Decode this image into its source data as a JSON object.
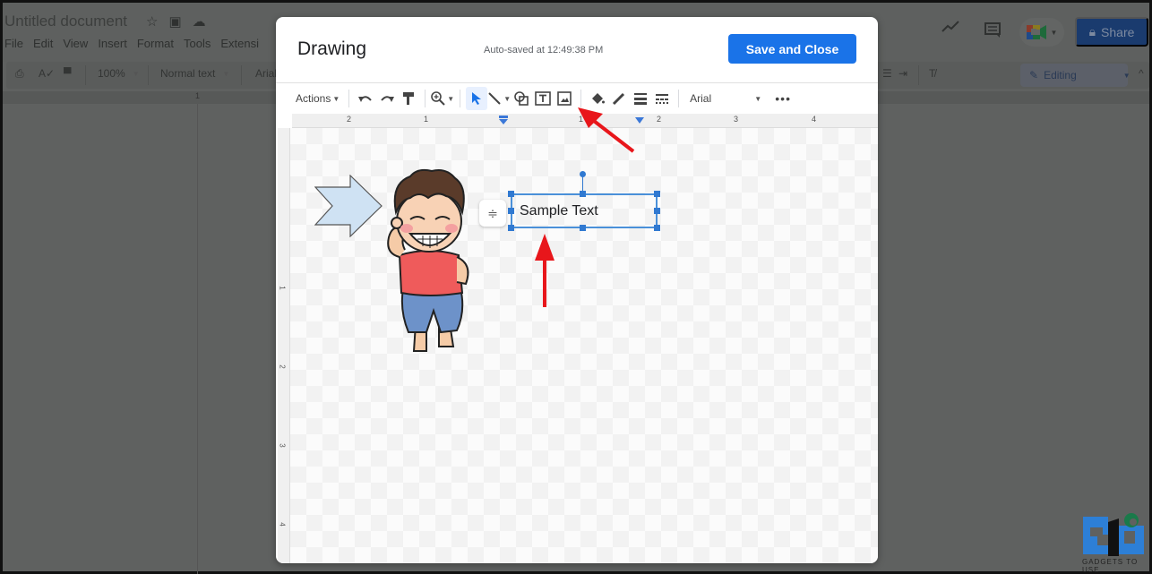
{
  "app": {
    "document_title": "Untitled document",
    "menu": [
      "File",
      "Edit",
      "View",
      "Insert",
      "Format",
      "Tools",
      "Extensi"
    ],
    "toolbar": {
      "zoom": "100%",
      "style": "Normal text",
      "font": "Arial"
    },
    "share_label": "Share",
    "mode_label": "Editing",
    "ruler_mark": "1"
  },
  "dialog": {
    "title": "Drawing",
    "autosave": "Auto-saved at 12:49:38 PM",
    "save_close_label": "Save and Close",
    "toolbar": {
      "actions_label": "Actions",
      "font": "Arial"
    },
    "h_ruler": [
      "2",
      "1",
      "1",
      "2",
      "3",
      "4"
    ],
    "v_ruler": [
      "1",
      "2",
      "3",
      "4"
    ],
    "textbox_text": "Sample Text"
  },
  "annotations": {
    "arrow_color": "#e8161b",
    "selection_color": "#3079d1",
    "accent_color": "#1a73e8"
  },
  "watermark": {
    "text": "GADGETS TO USE"
  }
}
